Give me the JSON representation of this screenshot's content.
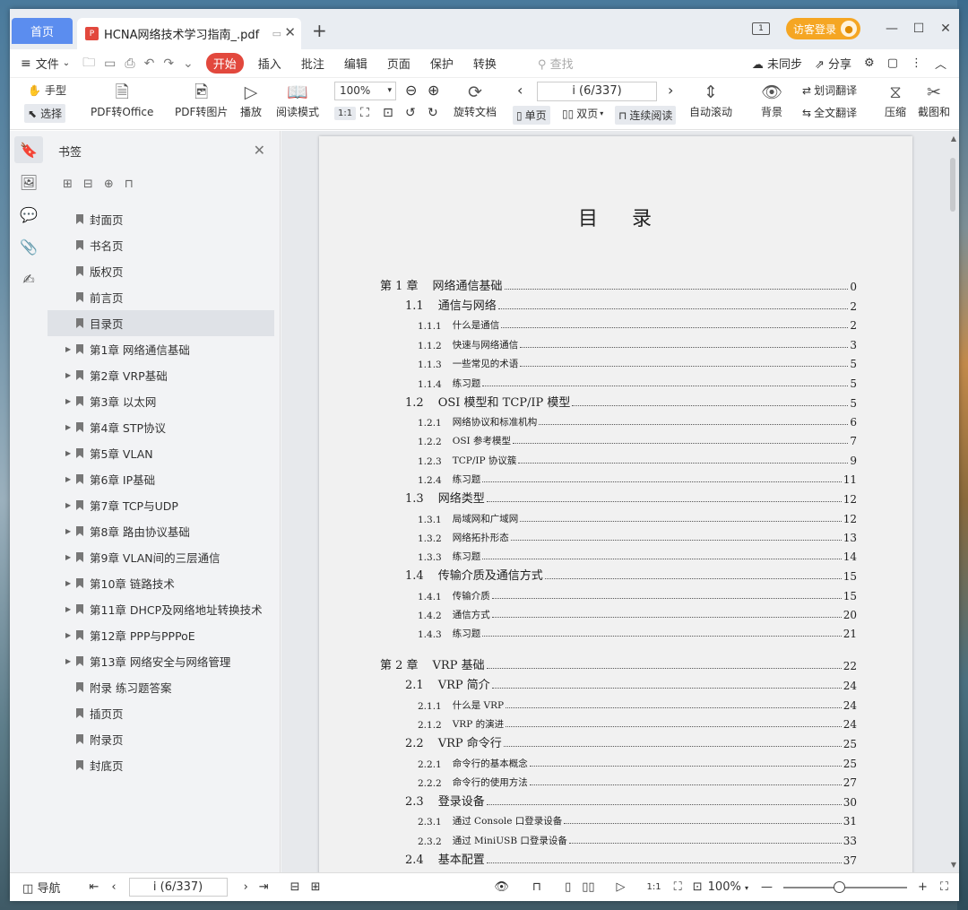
{
  "titlebar": {
    "home_tab": "首页",
    "doc_tab_title": "HCNA网络技术学习指南_.pdf",
    "login_label": "访客登录"
  },
  "menu": {
    "file": "文件",
    "items": [
      "开始",
      "插入",
      "批注",
      "编辑",
      "页面",
      "保护",
      "转换"
    ],
    "search_placeholder": "查找",
    "sync": "未同步",
    "share": "分享"
  },
  "toolbar": {
    "hand": "手型",
    "select": "选择",
    "pdf_to_office": "PDF转Office",
    "pdf_to_image": "PDF转图片",
    "play": "播放",
    "read_mode": "阅读模式",
    "zoom": "100%",
    "rotate": "旋转文档",
    "page_indicator": "i (6/337)",
    "single_page": "单页",
    "double_page": "双页",
    "continuous": "连续阅读",
    "auto_scroll": "自动滚动",
    "background": "背景",
    "word_translate": "划词翻译",
    "full_translate": "全文翻译",
    "compress": "压缩",
    "screenshot": "截图和"
  },
  "sidebar": {
    "title": "书签",
    "bookmarks": [
      {
        "label": "封面页",
        "expandable": false,
        "selected": false
      },
      {
        "label": "书名页",
        "expandable": false,
        "selected": false
      },
      {
        "label": "版权页",
        "expandable": false,
        "selected": false
      },
      {
        "label": "前言页",
        "expandable": false,
        "selected": false
      },
      {
        "label": "目录页",
        "expandable": false,
        "selected": true
      },
      {
        "label": "第1章  网络通信基础",
        "expandable": true,
        "selected": false
      },
      {
        "label": "第2章  VRP基础",
        "expandable": true,
        "selected": false
      },
      {
        "label": "第3章  以太网",
        "expandable": true,
        "selected": false
      },
      {
        "label": "第4章  STP协议",
        "expandable": true,
        "selected": false
      },
      {
        "label": "第5章  VLAN",
        "expandable": true,
        "selected": false
      },
      {
        "label": "第6章  IP基础",
        "expandable": true,
        "selected": false
      },
      {
        "label": "第7章  TCP与UDP",
        "expandable": true,
        "selected": false
      },
      {
        "label": "第8章  路由协议基础",
        "expandable": true,
        "selected": false
      },
      {
        "label": "第9章  VLAN间的三层通信",
        "expandable": true,
        "selected": false
      },
      {
        "label": "第10章  链路技术",
        "expandable": true,
        "selected": false
      },
      {
        "label": "第11章  DHCP及网络地址转换技术",
        "expandable": true,
        "selected": false
      },
      {
        "label": "第12章  PPP与PPPoE",
        "expandable": true,
        "selected": false
      },
      {
        "label": "第13章  网络安全与网络管理",
        "expandable": true,
        "selected": false
      },
      {
        "label": "附录  练习题答案",
        "expandable": false,
        "selected": false
      },
      {
        "label": "插页页",
        "expandable": false,
        "selected": false
      },
      {
        "label": "附录页",
        "expandable": false,
        "selected": false
      },
      {
        "label": "封底页",
        "expandable": false,
        "selected": false
      }
    ]
  },
  "document": {
    "title": "目录",
    "toc": [
      {
        "level": 0,
        "num": "第 1 章",
        "text": "网络通信基础",
        "page": "0"
      },
      {
        "level": 1,
        "num": "1.1",
        "text": "通信与网络",
        "page": "2"
      },
      {
        "level": 2,
        "num": "1.1.1",
        "text": "什么是通信",
        "page": "2"
      },
      {
        "level": 2,
        "num": "1.1.2",
        "text": "快速与网络通信",
        "page": "3"
      },
      {
        "level": 2,
        "num": "1.1.3",
        "text": "一些常见的术语",
        "page": "5"
      },
      {
        "level": 2,
        "num": "1.1.4",
        "text": "练习题",
        "page": "5"
      },
      {
        "level": 1,
        "num": "1.2",
        "text": "OSI 模型和 TCP/IP 模型",
        "page": "5"
      },
      {
        "level": 2,
        "num": "1.2.1",
        "text": "网络协议和标准机构",
        "page": "6"
      },
      {
        "level": 2,
        "num": "1.2.2",
        "text": "OSI 参考模型",
        "page": "7"
      },
      {
        "level": 2,
        "num": "1.2.3",
        "text": "TCP/IP 协议簇",
        "page": "9"
      },
      {
        "level": 2,
        "num": "1.2.4",
        "text": "练习题",
        "page": "11"
      },
      {
        "level": 1,
        "num": "1.3",
        "text": "网络类型",
        "page": "12"
      },
      {
        "level": 2,
        "num": "1.3.1",
        "text": "局域网和广域网",
        "page": "12"
      },
      {
        "level": 2,
        "num": "1.3.2",
        "text": "网络拓扑形态",
        "page": "13"
      },
      {
        "level": 2,
        "num": "1.3.3",
        "text": "练习题",
        "page": "14"
      },
      {
        "level": 1,
        "num": "1.4",
        "text": "传输介质及通信方式",
        "page": "15"
      },
      {
        "level": 2,
        "num": "1.4.1",
        "text": "传输介质",
        "page": "15"
      },
      {
        "level": 2,
        "num": "1.4.2",
        "text": "通信方式",
        "page": "20"
      },
      {
        "level": 2,
        "num": "1.4.3",
        "text": "练习题",
        "page": "21"
      },
      {
        "level": 0,
        "num": "第 2 章",
        "text": "VRP 基础",
        "page": "22"
      },
      {
        "level": 1,
        "num": "2.1",
        "text": "VRP 简介",
        "page": "24"
      },
      {
        "level": 2,
        "num": "2.1.1",
        "text": "什么是 VRP",
        "page": "24"
      },
      {
        "level": 2,
        "num": "2.1.2",
        "text": "VRP 的演进",
        "page": "24"
      },
      {
        "level": 1,
        "num": "2.2",
        "text": "VRP 命令行",
        "page": "25"
      },
      {
        "level": 2,
        "num": "2.2.1",
        "text": "命令行的基本概念",
        "page": "25"
      },
      {
        "level": 2,
        "num": "2.2.2",
        "text": "命令行的使用方法",
        "page": "27"
      },
      {
        "level": 1,
        "num": "2.3",
        "text": "登录设备",
        "page": "30"
      },
      {
        "level": 2,
        "num": "2.3.1",
        "text": "通过 Console 口登录设备",
        "page": "31"
      },
      {
        "level": 2,
        "num": "2.3.2",
        "text": "通过 MiniUSB 口登录设备",
        "page": "33"
      },
      {
        "level": 1,
        "num": "2.4",
        "text": "基本配置",
        "page": "37"
      }
    ]
  },
  "statusbar": {
    "nav": "导航",
    "page_indicator": "i (6/337)",
    "zoom": "100%",
    "zoom_level_fraction": 0.45
  }
}
